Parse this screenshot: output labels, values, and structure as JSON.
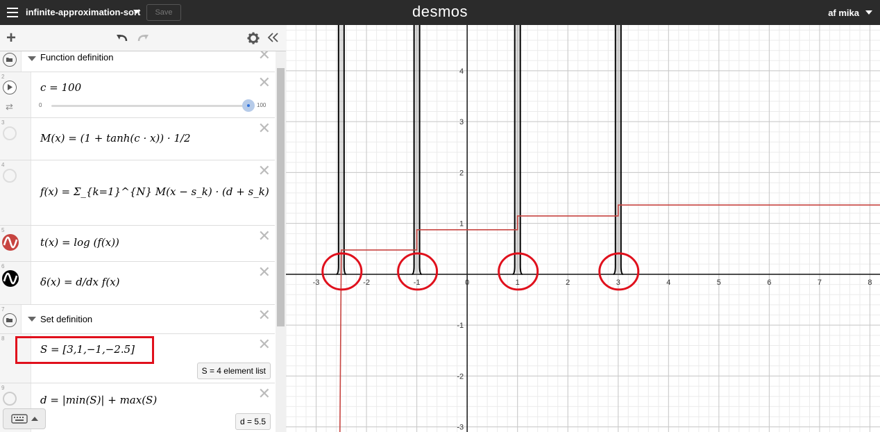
{
  "topbar": {
    "graph_title": "infinite-approximation-sort",
    "save_label": "Save",
    "brand": "desmos",
    "user": "af mika"
  },
  "expressions": [
    {
      "index": "",
      "kind": "folder",
      "title": "Function definition"
    },
    {
      "index": "2",
      "kind": "slider",
      "latex": "c = 100",
      "slider_min": "0",
      "slider_max": "100",
      "value": 100
    },
    {
      "index": "3",
      "kind": "expression",
      "latex": "M(x) = (1 + tanh(c · x)) · 1/2"
    },
    {
      "index": "4",
      "kind": "expression",
      "latex": "f(x) = Σ_{k=1}^{N} M(x − s_k) · (d + s_k)"
    },
    {
      "index": "5",
      "kind": "expression",
      "latex": "t(x) = log (f(x))",
      "color": "#c74440"
    },
    {
      "index": "6",
      "kind": "expression",
      "latex": "δ(x) = d/dx f(x)",
      "color": "#000000"
    },
    {
      "index": "7",
      "kind": "folder",
      "title": "Set definition"
    },
    {
      "index": "8",
      "kind": "expression",
      "latex": "S = [3,1,−1,−2.5]",
      "evaluation": "S  =  4 element list"
    },
    {
      "index": "9",
      "kind": "expression",
      "latex": "d = |min(S)| + max(S)",
      "evaluation": "d  =  5.5"
    }
  ],
  "graph": {
    "x_range": [
      -3.6,
      8.2
    ],
    "y_range": [
      -3.1,
      4.9
    ],
    "x_ticks": [
      "-3",
      "-2",
      "-1",
      "0",
      "1",
      "2",
      "3",
      "4",
      "5",
      "6",
      "7",
      "8"
    ],
    "y_ticks": [
      "-3",
      "-2",
      "-1",
      "1",
      "2",
      "3",
      "4"
    ],
    "spike_positions": [
      -2.5,
      -1,
      1,
      3
    ],
    "step_curve": {
      "color": "#c74440",
      "levels": [
        {
          "from": -2.5,
          "to": -1,
          "y": 0.477
        },
        {
          "from": -1,
          "to": 1,
          "y": 0.875
        },
        {
          "from": 1,
          "to": 3,
          "y": 1.146
        },
        {
          "from": 3,
          "to": 8.2,
          "y": 1.362
        }
      ]
    },
    "annotation_color": "#e0101c"
  },
  "icons": {
    "menu": "hamburger-icon",
    "add": "plus-icon",
    "undo": "undo-icon",
    "redo": "redo-icon",
    "settings": "gear-icon",
    "collapse": "double-chevron-left-icon",
    "keyboard": "keyboard-icon"
  }
}
